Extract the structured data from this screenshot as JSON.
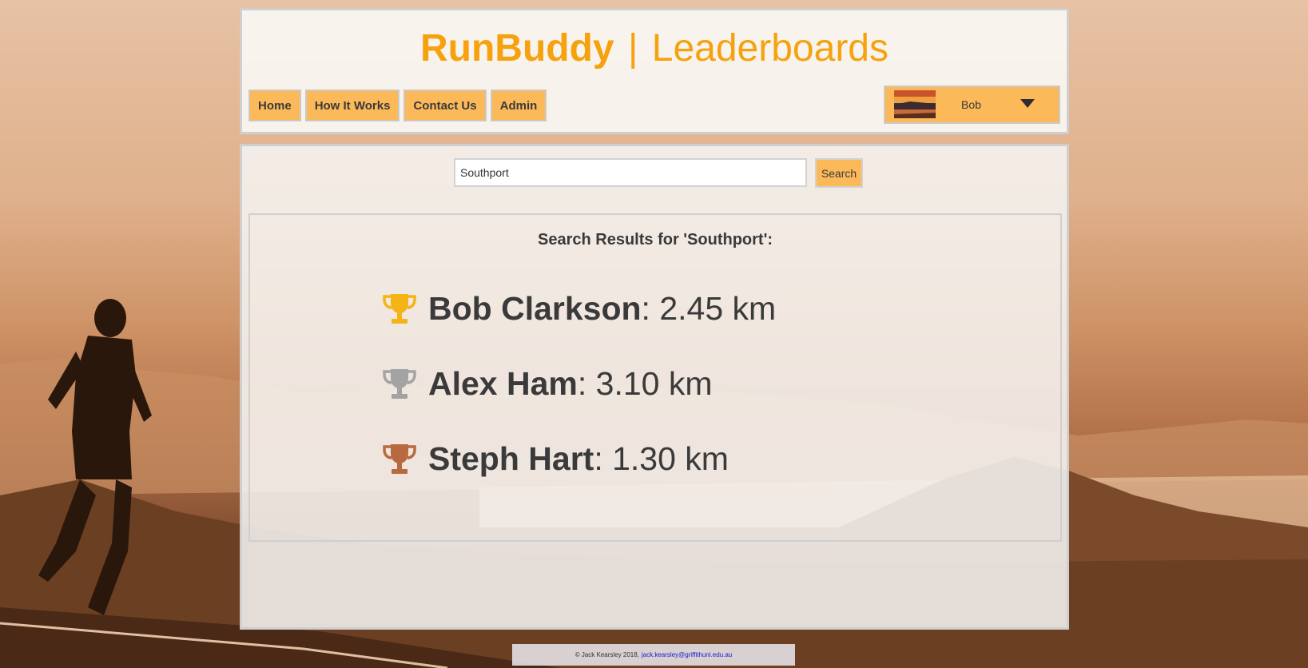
{
  "header": {
    "brand_name": "RunBuddy",
    "separator": "|",
    "section_title": "Leaderboards"
  },
  "nav": {
    "items": [
      {
        "label": "Home"
      },
      {
        "label": "How It Works"
      },
      {
        "label": "Contact Us"
      },
      {
        "label": "Admin"
      }
    ]
  },
  "user_menu": {
    "name": "Bob",
    "avatar_icon": "sunset-photo",
    "chevron_icon": "chevron-down-icon"
  },
  "search": {
    "value": "Southport",
    "button_label": "Search"
  },
  "results": {
    "title": "Search Results for 'Southport':",
    "items": [
      {
        "name": "Bob Clarkson",
        "distance": ": 2.45 km",
        "trophy": "gold-trophy",
        "color": "#f5b415"
      },
      {
        "name": "Alex Ham",
        "distance": ": 3.10 km",
        "trophy": "silver-trophy",
        "color": "#a3a3a3"
      },
      {
        "name": "Steph Hart",
        "distance": ": 1.30 km",
        "trophy": "bronze-trophy",
        "color": "#b86a3e"
      }
    ]
  },
  "footer": {
    "text": "© Jack Kearsley 2018,",
    "email": "jack.kearsley@griffithuni.edu.au"
  },
  "colors": {
    "brand_orange": "#f6a20e",
    "button_orange": "#fbb95a",
    "text_dark": "#3a3a3a"
  }
}
